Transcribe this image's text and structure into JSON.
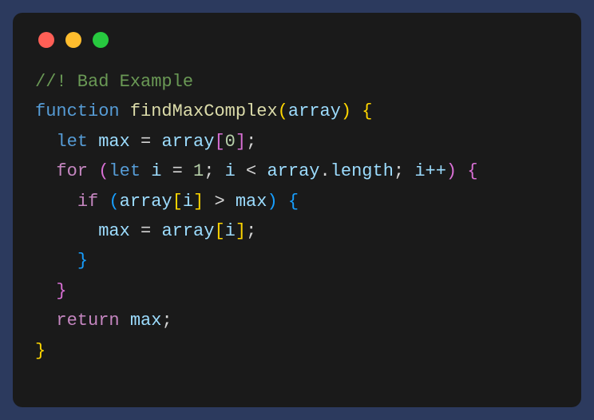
{
  "window": {
    "traffic_lights": [
      "red",
      "yellow",
      "green"
    ]
  },
  "code": {
    "comment": "//! Bad Example",
    "kw_function": "function",
    "fn_name": "findMaxComplex",
    "param_array": "array",
    "kw_let": "let",
    "var_max": "max",
    "eq": " = ",
    "num_0": "0",
    "semicolon": ";",
    "kw_for": "for",
    "var_i": "i",
    "num_1": "1",
    "lt": " < ",
    "dot": ".",
    "prop_length": "length",
    "ipp": "i++",
    "kw_if": "if",
    "gt": " > ",
    "kw_return": "return",
    "open_paren": "(",
    "close_paren": ")",
    "open_brace": "{",
    "close_brace": "}",
    "open_bracket": "[",
    "close_bracket": "]",
    "indent1": "  ",
    "indent2": "    ",
    "indent3": "      ",
    "space": " "
  }
}
